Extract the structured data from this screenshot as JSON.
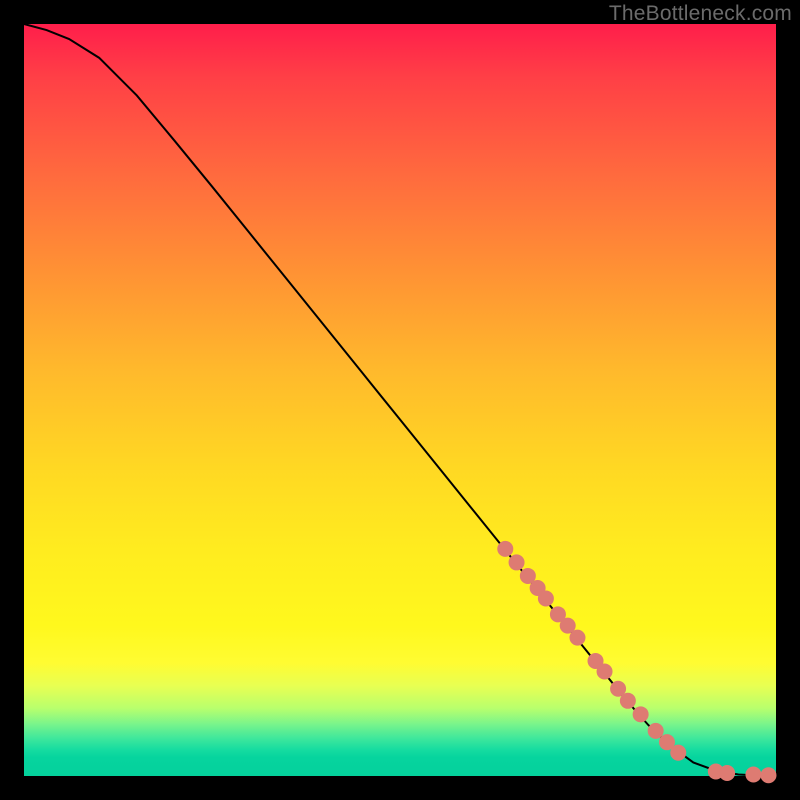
{
  "watermark": "TheBottleneck.com",
  "chart_data": {
    "type": "line",
    "title": "",
    "xlabel": "",
    "ylabel": "",
    "xlim": [
      0,
      100
    ],
    "ylim": [
      0,
      100
    ],
    "grid": false,
    "legend": false,
    "background_gradient": {
      "type": "linear-vertical",
      "stops": [
        {
          "pos": 0.0,
          "color": "#ff1e4b"
        },
        {
          "pos": 0.35,
          "color": "#ff9234"
        },
        {
          "pos": 0.7,
          "color": "#ffec1f"
        },
        {
          "pos": 0.9,
          "color": "#b8ff6d"
        },
        {
          "pos": 1.0,
          "color": "#04d19c"
        }
      ]
    },
    "series": [
      {
        "name": "bottleneck-curve",
        "color": "#000000",
        "stroke_width": 2,
        "x": [
          0,
          3,
          6,
          10,
          15,
          20,
          25,
          30,
          35,
          40,
          45,
          50,
          55,
          60,
          65,
          70,
          75,
          80,
          83,
          86,
          89,
          92,
          95,
          97,
          100
        ],
        "y": [
          100,
          99.2,
          98.0,
          95.5,
          90.5,
          84.5,
          78.4,
          72.2,
          66.0,
          59.8,
          53.6,
          47.4,
          41.2,
          35.0,
          28.8,
          22.6,
          16.4,
          10.2,
          6.8,
          4.0,
          1.8,
          0.7,
          0.2,
          0.1,
          0.1
        ]
      }
    ],
    "scatter_highlights": {
      "name": "marker-dots",
      "color": "#de7b72",
      "radius": 8,
      "points": [
        {
          "x": 64.0,
          "y": 30.2
        },
        {
          "x": 65.5,
          "y": 28.4
        },
        {
          "x": 67.0,
          "y": 26.6
        },
        {
          "x": 68.3,
          "y": 25.0
        },
        {
          "x": 69.4,
          "y": 23.6
        },
        {
          "x": 71.0,
          "y": 21.5
        },
        {
          "x": 72.3,
          "y": 20.0
        },
        {
          "x": 73.6,
          "y": 18.4
        },
        {
          "x": 76.0,
          "y": 15.3
        },
        {
          "x": 77.2,
          "y": 13.9
        },
        {
          "x": 79.0,
          "y": 11.6
        },
        {
          "x": 80.3,
          "y": 10.0
        },
        {
          "x": 82.0,
          "y": 8.2
        },
        {
          "x": 84.0,
          "y": 6.0
        },
        {
          "x": 85.5,
          "y": 4.5
        },
        {
          "x": 87.0,
          "y": 3.1
        },
        {
          "x": 92.0,
          "y": 0.6
        },
        {
          "x": 93.5,
          "y": 0.4
        },
        {
          "x": 97.0,
          "y": 0.2
        },
        {
          "x": 99.0,
          "y": 0.1
        }
      ]
    }
  }
}
